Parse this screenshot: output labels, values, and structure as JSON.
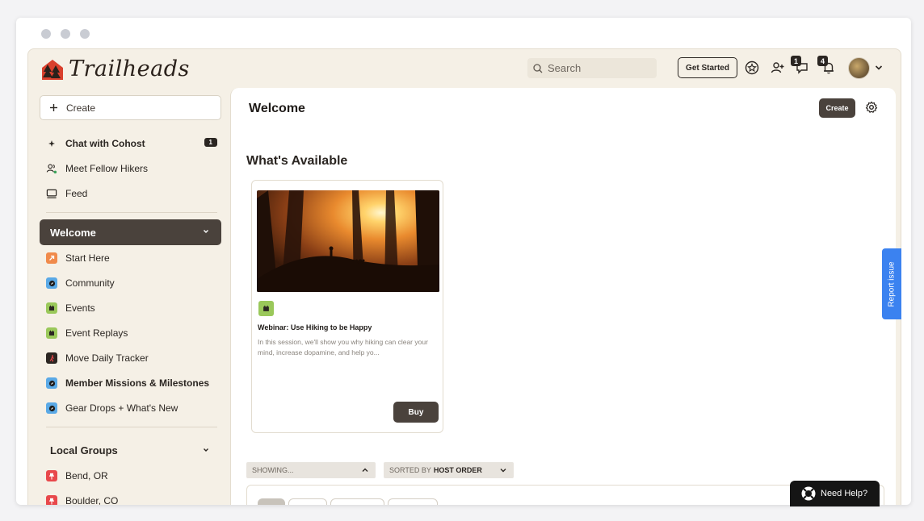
{
  "brand": {
    "name": "Trailheads"
  },
  "header": {
    "search_placeholder": "Search",
    "get_started_label": "Get Started",
    "messages_badge": "1",
    "notifications_badge": "4"
  },
  "sidebar": {
    "create_label": "Create",
    "top_items": [
      {
        "label": "Chat with Cohost",
        "icon": "sparkle-icon",
        "badge": "1"
      },
      {
        "label": "Meet Fellow Hikers",
        "icon": "people-icon"
      },
      {
        "label": "Feed",
        "icon": "feed-icon"
      }
    ],
    "active_section": "Welcome",
    "welcome_items": [
      {
        "label": "Start Here",
        "icon": "arrow-up-right-icon",
        "color": "#f08a4b"
      },
      {
        "label": "Community",
        "icon": "compass-icon",
        "color": "#5aa9e6"
      },
      {
        "label": "Events",
        "icon": "calendar-icon",
        "color": "#9ac85a"
      },
      {
        "label": "Event Replays",
        "icon": "calendar-icon",
        "color": "#9ac85a"
      },
      {
        "label": "Move Daily Tracker",
        "icon": "runner-icon",
        "color": "#2b2622"
      },
      {
        "label": "Member Missions & Milestones",
        "icon": "compass-icon",
        "color": "#5aa9e6"
      },
      {
        "label": "Gear Drops + What's New",
        "icon": "compass-icon",
        "color": "#5aa9e6"
      }
    ],
    "local_groups_title": "Local Groups",
    "local_groups": [
      {
        "label": "Bend, OR",
        "icon": "pin-icon",
        "color": "#e8484b"
      },
      {
        "label": "Boulder, CO",
        "icon": "pin-icon",
        "color": "#e8484b"
      }
    ]
  },
  "main": {
    "title": "Welcome",
    "create_label": "Create",
    "section_title": "What's Available",
    "card": {
      "title": "Webinar: Use Hiking to be Happy",
      "description": "In this session, we'll show you why hiking can clear your mind, increase dopamine, and help yo...",
      "buy_label": "Buy"
    },
    "filters": {
      "showing_label": "SHOWING...",
      "sort_prefix": "SORTED BY",
      "sort_value": "HOST ORDER"
    }
  },
  "report_issue_label": "Report issue",
  "help_label": "Need Help?"
}
